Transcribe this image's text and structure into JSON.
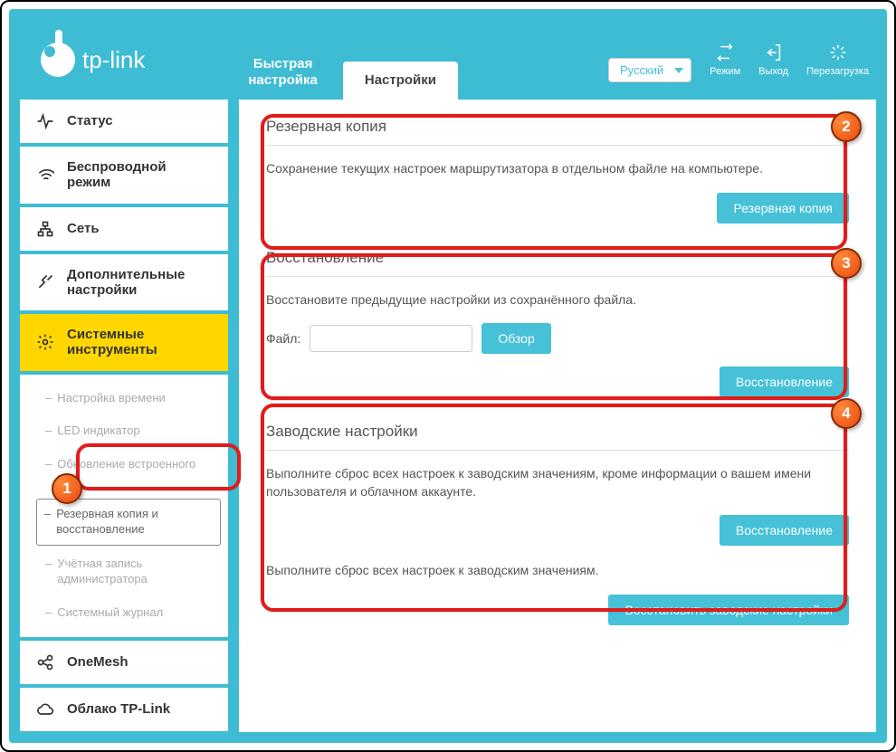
{
  "brand": "tp-link",
  "tabs": {
    "quick": "Быстрая\nнастройка",
    "advanced": "Настройки"
  },
  "header": {
    "language": "Русский",
    "mode": "Режим",
    "logout": "Выход",
    "reboot": "Перезагрузка"
  },
  "nav": {
    "status": "Статус",
    "wireless": "Беспроводной режим",
    "network": "Сеть",
    "advanced": "Дополнительные настройки",
    "system": "Системные инструменты",
    "onemesh": "OneMesh",
    "cloud": "Облако TP-Link"
  },
  "subnav": {
    "time": "Настройка времени",
    "led": "LED индикатор",
    "firmware": "Обновление встроенного ПО",
    "backup": "Резервная копия и восстановление",
    "admin": "Учётная запись администратора",
    "syslog": "Системный журнал"
  },
  "panels": {
    "backup": {
      "title": "Резервная копия",
      "text": "Сохранение текущих настроек маршрутизатора в отдельном файле на компьютере.",
      "button": "Резервная копия"
    },
    "restore": {
      "title": "Восстановление",
      "text": "Восстановите предыдущие настройки из сохранённого файла.",
      "fileLabel": "Файл:",
      "browse": "Обзор",
      "button": "Восстановление"
    },
    "factory": {
      "title": "Заводские настройки",
      "text1": "Выполните сброс всех настроек к заводским значениям, кроме информации о вашем имени пользователя и облачном аккаунте.",
      "button1": "Восстановление",
      "text2": "Выполните сброс всех настроек к заводским значениям.",
      "button2": "Восстановить заводские настройки"
    }
  },
  "annotations": {
    "n1": "1",
    "n2": "2",
    "n3": "3",
    "n4": "4"
  }
}
